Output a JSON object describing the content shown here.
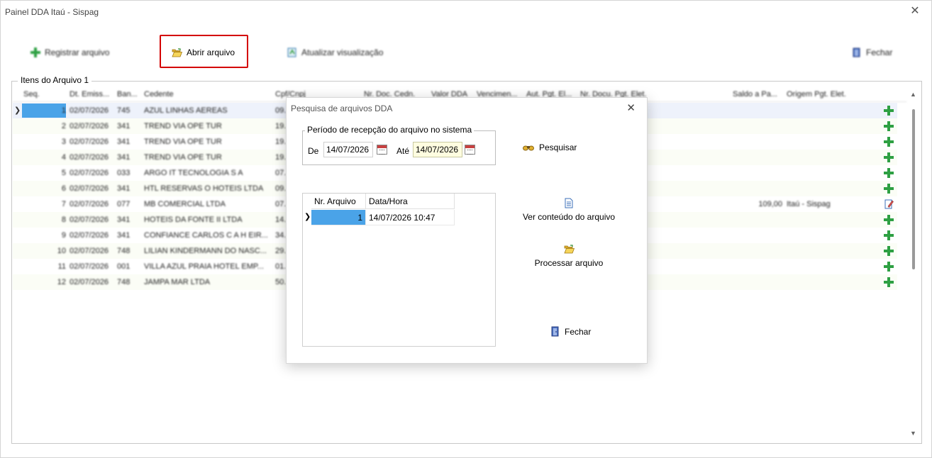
{
  "window": {
    "title": "Painel DDA Itaú - Sispag",
    "close": "✕"
  },
  "toolbar": {
    "register_label": "Registrar arquivo",
    "open_label": "Abrir arquivo",
    "refresh_label": "Atualizar visualização",
    "close_label": "Fechar"
  },
  "group": {
    "title": "Itens do Arquivo 1"
  },
  "grid": {
    "headers": {
      "seq": "Seq.",
      "dt_emiss": "Dt. Emiss...",
      "banco": "Ban...",
      "cedente": "Cedente",
      "cpf": "Cpf/Cnpj",
      "nr_doc": "Nr. Doc. Cedn.",
      "valor": "Valor DDA",
      "venc": "Vencimen...",
      "aut_pgto": "Aut. Pgt. El...",
      "nr_doc_pgt": "Nr. Docu. Pgt. Elet.",
      "saldo": "Saldo a Pa...",
      "origem": "Origem Pgt. Elet."
    },
    "rows": [
      {
        "seq": "1",
        "date": "02/07/2026",
        "bank": "745",
        "cedente": "AZUL LINHAS AEREAS",
        "cpf": "09.",
        "saldo": "",
        "origem": "",
        "action": "add"
      },
      {
        "seq": "2",
        "date": "02/07/2026",
        "bank": "341",
        "cedente": "TREND VIA OPE TUR",
        "cpf": "19.",
        "saldo": "",
        "origem": "",
        "action": "add"
      },
      {
        "seq": "3",
        "date": "02/07/2026",
        "bank": "341",
        "cedente": "TREND VIA OPE TUR",
        "cpf": "19.",
        "saldo": "",
        "origem": "",
        "action": "add"
      },
      {
        "seq": "4",
        "date": "02/07/2026",
        "bank": "341",
        "cedente": "TREND VIA OPE TUR",
        "cpf": "19.",
        "saldo": "",
        "origem": "",
        "action": "add"
      },
      {
        "seq": "5",
        "date": "02/07/2026",
        "bank": "033",
        "cedente": "ARGO IT TECNOLOGIA S A",
        "cpf": "07.",
        "saldo": "",
        "origem": "",
        "action": "add"
      },
      {
        "seq": "6",
        "date": "02/07/2026",
        "bank": "341",
        "cedente": "HTL RESERVAS O HOTEIS LTDA",
        "cpf": "09.",
        "saldo": "",
        "origem": "",
        "action": "add"
      },
      {
        "seq": "7",
        "date": "02/07/2026",
        "bank": "077",
        "cedente": "MB COMERCIAL LTDA",
        "cpf": "07.",
        "saldo": "109,00",
        "origem": "Itaú - Sispag",
        "action": "edit"
      },
      {
        "seq": "8",
        "date": "02/07/2026",
        "bank": "341",
        "cedente": "HOTEIS DA FONTE II LTDA",
        "cpf": "14.",
        "saldo": "",
        "origem": "",
        "action": "add"
      },
      {
        "seq": "9",
        "date": "02/07/2026",
        "bank": "341",
        "cedente": "CONFIANCE CARLOS C A H EIR...",
        "cpf": "34.",
        "saldo": "",
        "origem": "",
        "action": "add"
      },
      {
        "seq": "10",
        "date": "02/07/2026",
        "bank": "748",
        "cedente": "LILIAN KINDERMANN DO NASC...",
        "cpf": "29.",
        "saldo": "",
        "origem": "",
        "action": "add"
      },
      {
        "seq": "11",
        "date": "02/07/2026",
        "bank": "001",
        "cedente": "VILLA AZUL PRAIA HOTEL EMP...",
        "cpf": "01.",
        "saldo": "",
        "origem": "",
        "action": "add"
      },
      {
        "seq": "12",
        "date": "02/07/2026",
        "bank": "748",
        "cedente": "JAMPA MAR LTDA",
        "cpf": "50.",
        "saldo": "",
        "origem": "",
        "action": "add"
      }
    ]
  },
  "dialog": {
    "title": "Pesquisa de arquivos DDA",
    "close": "✕",
    "period_title": "Período de recepção do arquivo no sistema",
    "from_label": "De",
    "from_value": "14/07/2026",
    "to_label": "Até",
    "to_value": "14/07/2026",
    "search_label": "Pesquisar",
    "view_label": "Ver conteúdo do arquivo",
    "process_label": "Processar arquivo",
    "close_label": "Fechar",
    "files": {
      "headers": {
        "nr": "Nr. Arquivo",
        "datetime": "Data/Hora"
      },
      "rows": [
        {
          "nr": "1",
          "datetime": "14/07/2026 10:47"
        }
      ]
    }
  },
  "colors": {
    "highlight": "#d40000",
    "selection": "#4aa3e8",
    "add_icon": "#2ea043",
    "focus_input": "#fffde0"
  }
}
